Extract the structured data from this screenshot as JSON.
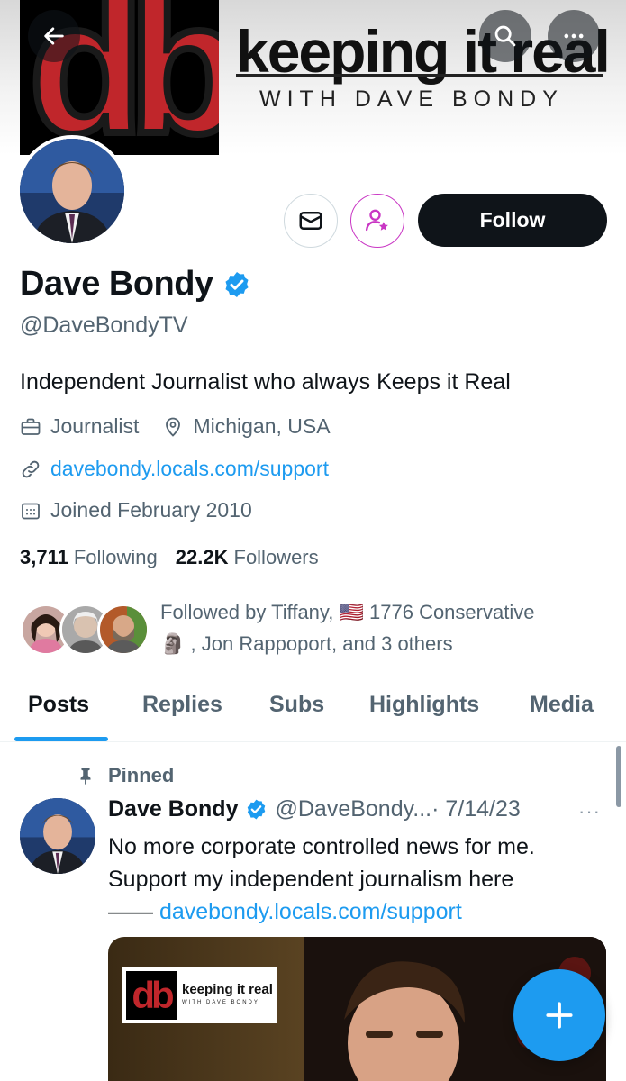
{
  "banner": {
    "logo_text": "db",
    "title": "keeping it real",
    "subtitle": "WITH DAVE BONDY"
  },
  "profile": {
    "display_name": "Dave Bondy",
    "handle": "@DaveBondyTV",
    "bio": "Independent Journalist who always Keeps it Real",
    "profession": "Journalist",
    "location": "Michigan, USA",
    "website": "davebondy.locals.com/support",
    "joined": "Joined February 2010",
    "following_count": "3,711",
    "following_label": "Following",
    "followers_count": "22.2K",
    "followers_label": "Followers",
    "followed_by_line1": "Followed by Tiffany, 🇺🇸 1776 Conservative",
    "followed_by_line2": "🗿 , Jon Rappoport, and 3 others"
  },
  "actions": {
    "follow_label": "Follow"
  },
  "tabs": [
    {
      "label": "Posts",
      "active": true
    },
    {
      "label": "Replies",
      "active": false
    },
    {
      "label": "Subs",
      "active": false
    },
    {
      "label": "Highlights",
      "active": false
    },
    {
      "label": "Media",
      "active": false
    }
  ],
  "pinned_post": {
    "pinned_label": "Pinned",
    "author_name": "Dave Bondy",
    "author_handle": "@DaveBondy...",
    "date": "· 7/14/23",
    "more": "···",
    "text_line1": "No more corporate controlled news for me.",
    "text_line2": "Support my independent journalism here",
    "text_prefix": "—— ",
    "text_link": "davebondy.locals.com/support",
    "media_logo_letters": "db",
    "media_logo_title": "keeping it real",
    "media_logo_subtitle": "WITH DAVE BONDY"
  },
  "colors": {
    "accent": "#1d9bf0",
    "text_primary": "#0f1419",
    "text_secondary": "#536471",
    "follow_bg": "#0f1419",
    "subscribe_accent": "#c936c4",
    "logo_red": "#c0262b"
  },
  "icons": {
    "back": "arrow-left-icon",
    "search": "search-icon",
    "more": "more-horizontal-icon",
    "message": "envelope-icon",
    "subscribe": "person-star-icon",
    "verified": "verified-badge-icon",
    "profession": "briefcase-icon",
    "location": "map-pin-icon",
    "link": "link-icon",
    "calendar": "calendar-icon",
    "pin": "pin-icon",
    "compose": "plus-icon"
  }
}
